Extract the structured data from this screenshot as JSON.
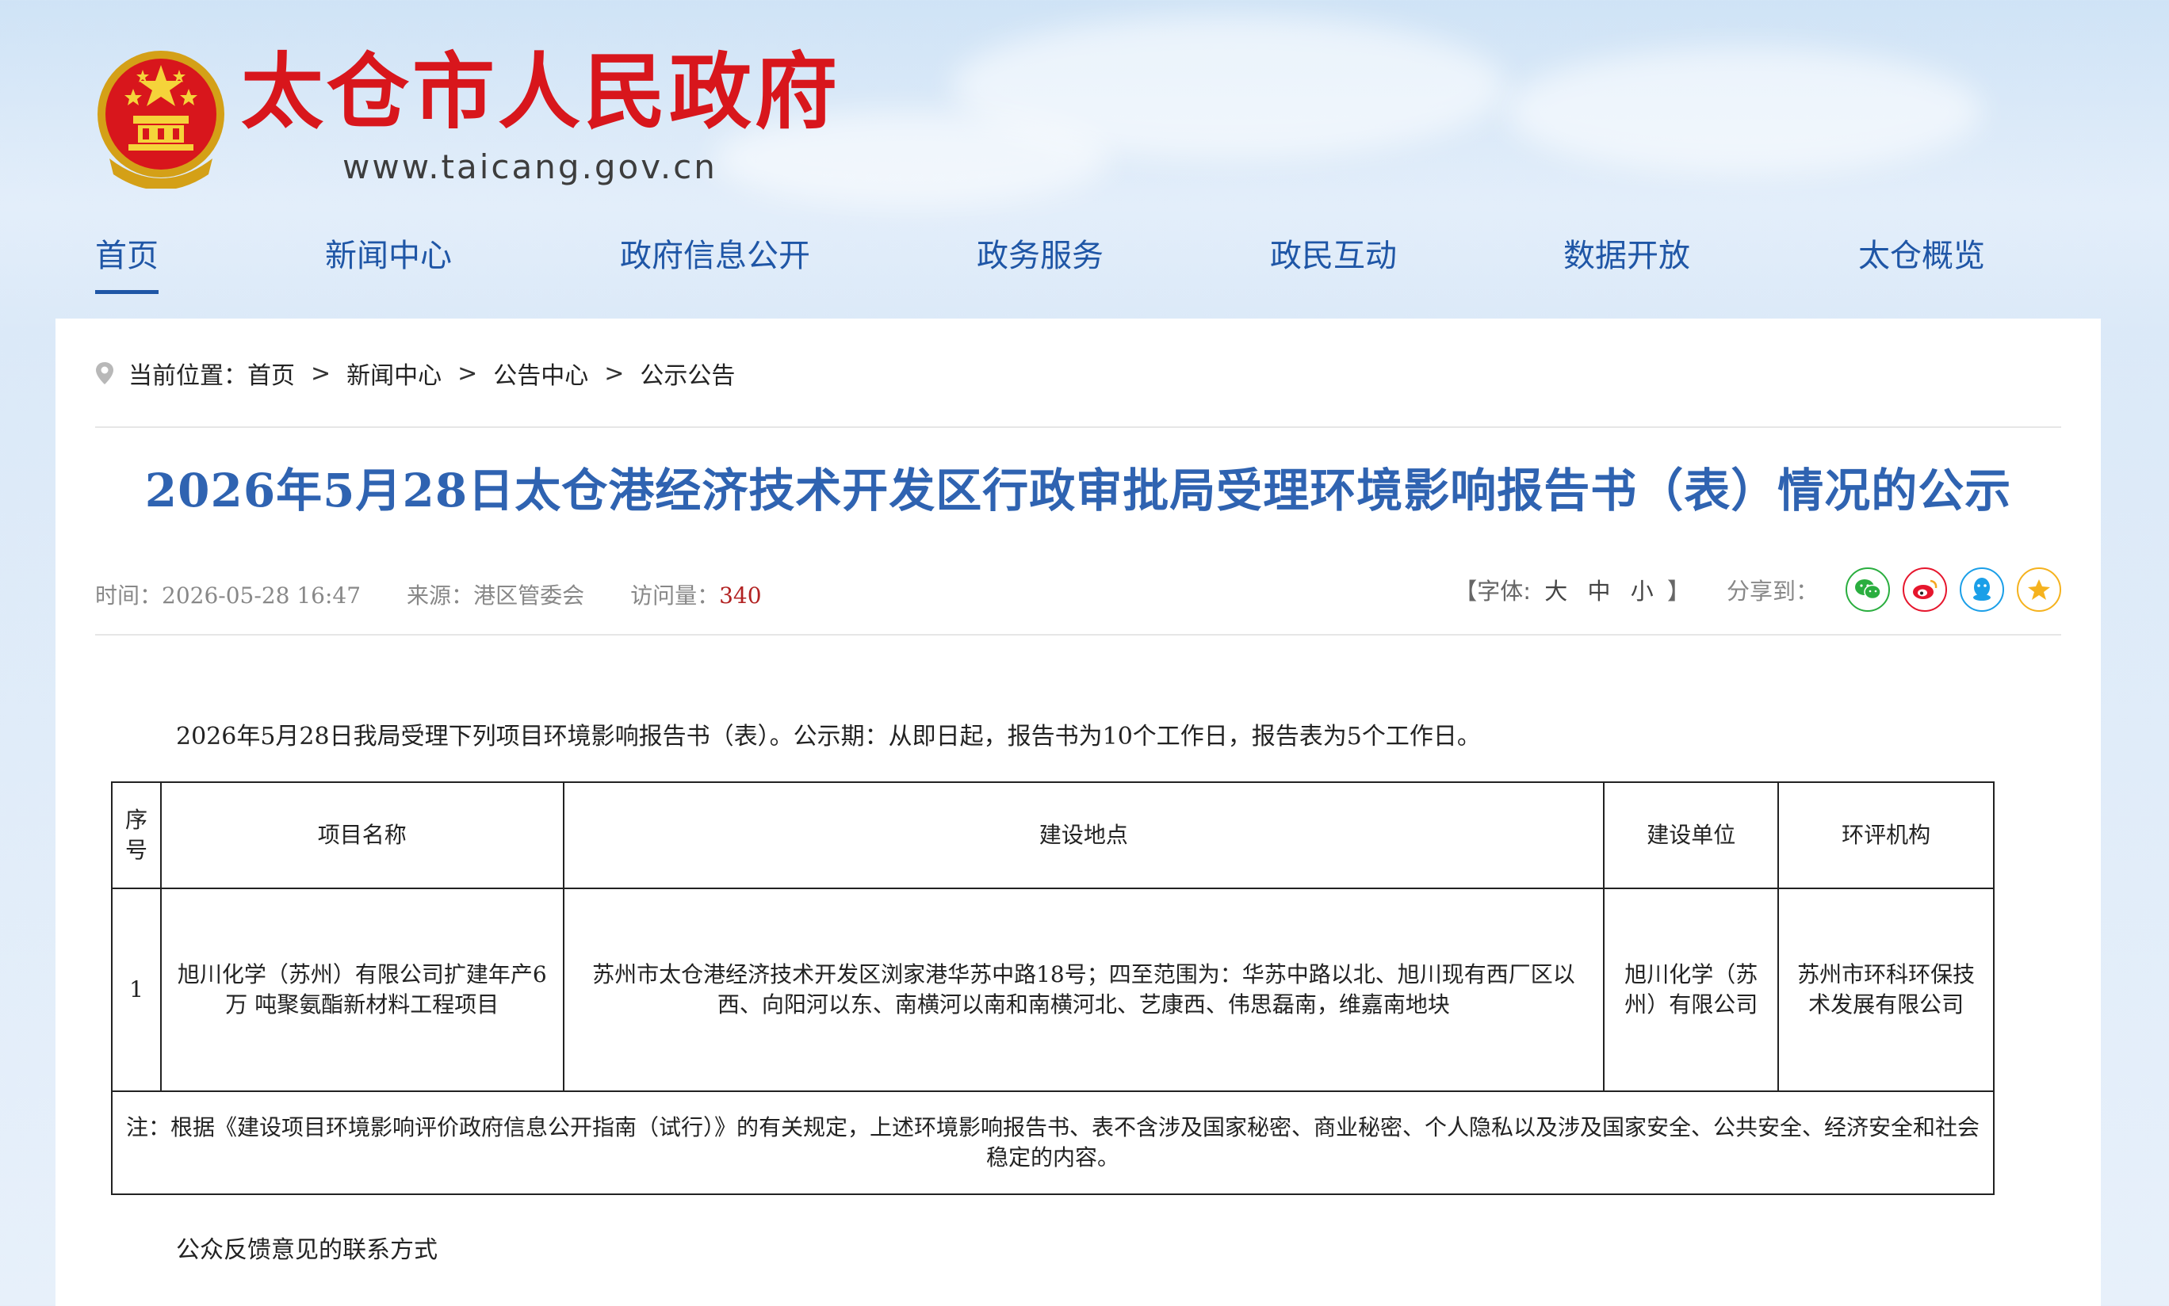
{
  "header": {
    "site_title": "太仓市人民政府",
    "site_url": "www.taicang.gov.cn",
    "emblem_icon": "national-emblem-icon"
  },
  "nav": {
    "items": [
      {
        "label": "首页",
        "active": true
      },
      {
        "label": "新闻中心"
      },
      {
        "label": "政府信息公开"
      },
      {
        "label": "政务服务"
      },
      {
        "label": "政民互动"
      },
      {
        "label": "数据开放"
      },
      {
        "label": "太仓概览"
      }
    ]
  },
  "breadcrumb": {
    "prefix": "当前位置：",
    "items": [
      "首页",
      "新闻中心",
      "公告中心",
      "公示公告"
    ],
    "separator": ">"
  },
  "article": {
    "title": "2026年5月28日太仓港经济技术开发区行政审批局受理环境影响报告书（表）情况的公示",
    "time_label": "时间：",
    "time": "2026-05-28 16:47",
    "source_label": "来源：",
    "source": "港区管委会",
    "views_label": "访问量：",
    "views": "340",
    "font_label_open": "【字体:",
    "font_sizes": [
      "大",
      "中",
      "小"
    ],
    "font_label_close": "】",
    "share_label": "分享到：",
    "share_icons": [
      "wechat-icon",
      "weibo-icon",
      "qq-icon",
      "qzone-icon"
    ],
    "intro": "2026年5月28日我局受理下列项目环境影响报告书（表）。公示期：从即日起，报告书为10个工作日，报告表为5个工作日。",
    "feedback_heading": "公众反馈意见的联系方式"
  },
  "table": {
    "headers": [
      "序号",
      "项目名称",
      "建设地点",
      "建设单位",
      "环评机构"
    ],
    "rows": [
      [
        "1",
        "旭川化学（苏州）有限公司扩建年产6万 吨聚氨酯新材料工程项目",
        "苏州市太仓港经济技术开发区浏家港华苏中路18号；四至范围为：华苏中路以北、旭川现有西厂区以西、向阳河以东、南横河以南和南横河北、艺康西、伟思磊南，维嘉南地块",
        "旭川化学（苏州）有限公司",
        "苏州市环科环保技术发展有限公司"
      ]
    ],
    "note": "注：根据《建设项目环境影响评价政府信息公开指南（试行）》的有关规定，上述环境影响报告书、表不含涉及国家秘密、商业秘密、个人隐私以及涉及国家安全、公共安全、经济安全和社会稳定的内容。"
  },
  "colors": {
    "brand_red": "#d8161c",
    "nav_blue": "#1f56a6",
    "title_blue": "#2f63b1",
    "wechat_green": "#2aae3f",
    "weibo_red": "#e6162d",
    "qq_blue": "#1b9fe8",
    "qzone_yellow": "#f5b21e"
  }
}
